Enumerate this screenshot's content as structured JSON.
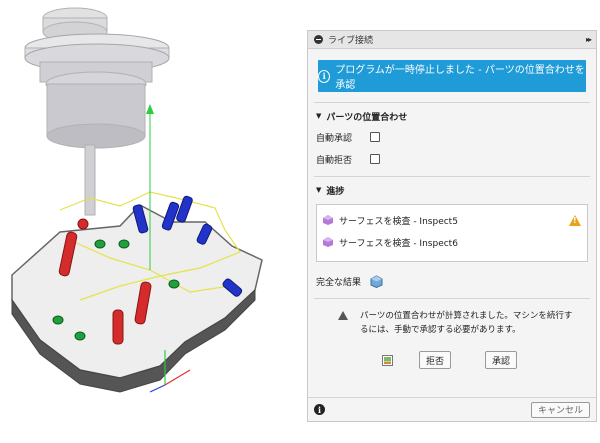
{
  "panel": {
    "title": "ライブ接続",
    "expand_glyph": "▸▸",
    "banner_text": "プログラムが一時停止しました - パーツの位置合わせを承認",
    "banner_icon": "info-icon",
    "alignment": {
      "header": "パーツの位置合わせ",
      "auto_accept_label": "自動承認",
      "auto_reject_label": "自動拒否"
    },
    "progress": {
      "header": "進捗",
      "items": [
        {
          "text": "サーフェスを検査 - Inspect5",
          "status": "warning"
        },
        {
          "text": "サーフェスを検査 - Inspect6",
          "status": ""
        }
      ]
    },
    "complete_results_label": "完全な結果",
    "message": "パーツの位置合わせが計算されました。マシンを続行するには、手動で承認する必要があります。",
    "reject_label": "拒否",
    "accept_label": "承認",
    "cancel_label": "キャンセル"
  },
  "colors": {
    "accent": "#1f9bd8",
    "warning": "#e8a21a"
  }
}
